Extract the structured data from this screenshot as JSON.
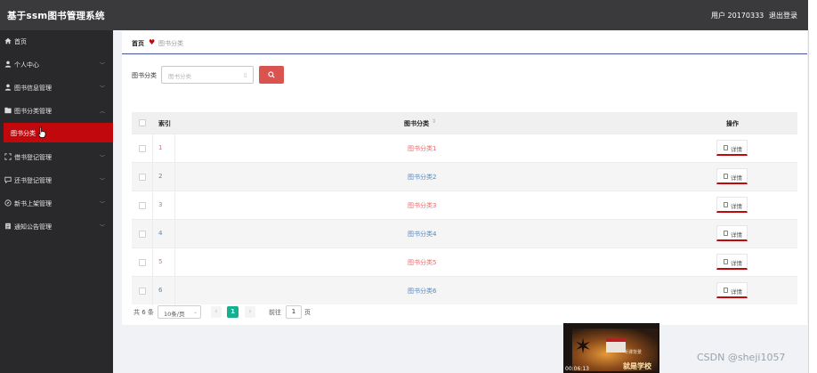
{
  "header": {
    "title": "基于ssm图书管理系统",
    "user": "用户 20170333",
    "logout": "退出登录"
  },
  "sidebar": {
    "items": [
      {
        "label": "首页",
        "icon": "home-icon",
        "has_arrow": false
      },
      {
        "label": "个人中心",
        "icon": "user-icon",
        "has_arrow": true
      },
      {
        "label": "图书信息管理",
        "icon": "user-icon",
        "has_arrow": true
      },
      {
        "label": "图书分类管理",
        "icon": "folder-icon",
        "has_arrow": true,
        "expanded": true
      },
      {
        "label": "借书登记管理",
        "icon": "expand-icon",
        "has_arrow": true
      },
      {
        "label": "还书登记管理",
        "icon": "message-icon",
        "has_arrow": true
      },
      {
        "label": "新书上架管理",
        "icon": "compass-icon",
        "has_arrow": true
      },
      {
        "label": "通知公告管理",
        "icon": "document-icon",
        "has_arrow": true
      }
    ],
    "active_sub": "图书分类"
  },
  "breadcrumb": {
    "home": "首页",
    "current": "图书分类"
  },
  "search": {
    "label": "图书分类",
    "placeholder": "图书分类",
    "button_icon": "search-icon"
  },
  "table": {
    "headers": {
      "index": "索引",
      "category": "图书分类",
      "operation": "操作"
    },
    "detail_label": "详情",
    "rows": [
      {
        "index": "1",
        "category": "图书分类1"
      },
      {
        "index": "2",
        "category": "图书分类2"
      },
      {
        "index": "3",
        "category": "图书分类3"
      },
      {
        "index": "4",
        "category": "图书分类4"
      },
      {
        "index": "5",
        "category": "图书分类5"
      },
      {
        "index": "6",
        "category": "图书分类6"
      }
    ]
  },
  "pager": {
    "total": "共 6 条",
    "page_size": "10条/页",
    "current_page": "1",
    "goto_label": "前往",
    "goto_value": "1",
    "goto_unit": "页"
  },
  "video": {
    "caption_small": "听课背景",
    "caption_large": "就是学校",
    "time": "00:06:13"
  },
  "watermark": "CSDN @sheji1057",
  "colors": {
    "header_bg": "#3a3a3c",
    "sidebar_bg": "#29292b",
    "active_red": "#c0080d",
    "search_button": "#d9534f",
    "page_active": "#14b08f"
  }
}
